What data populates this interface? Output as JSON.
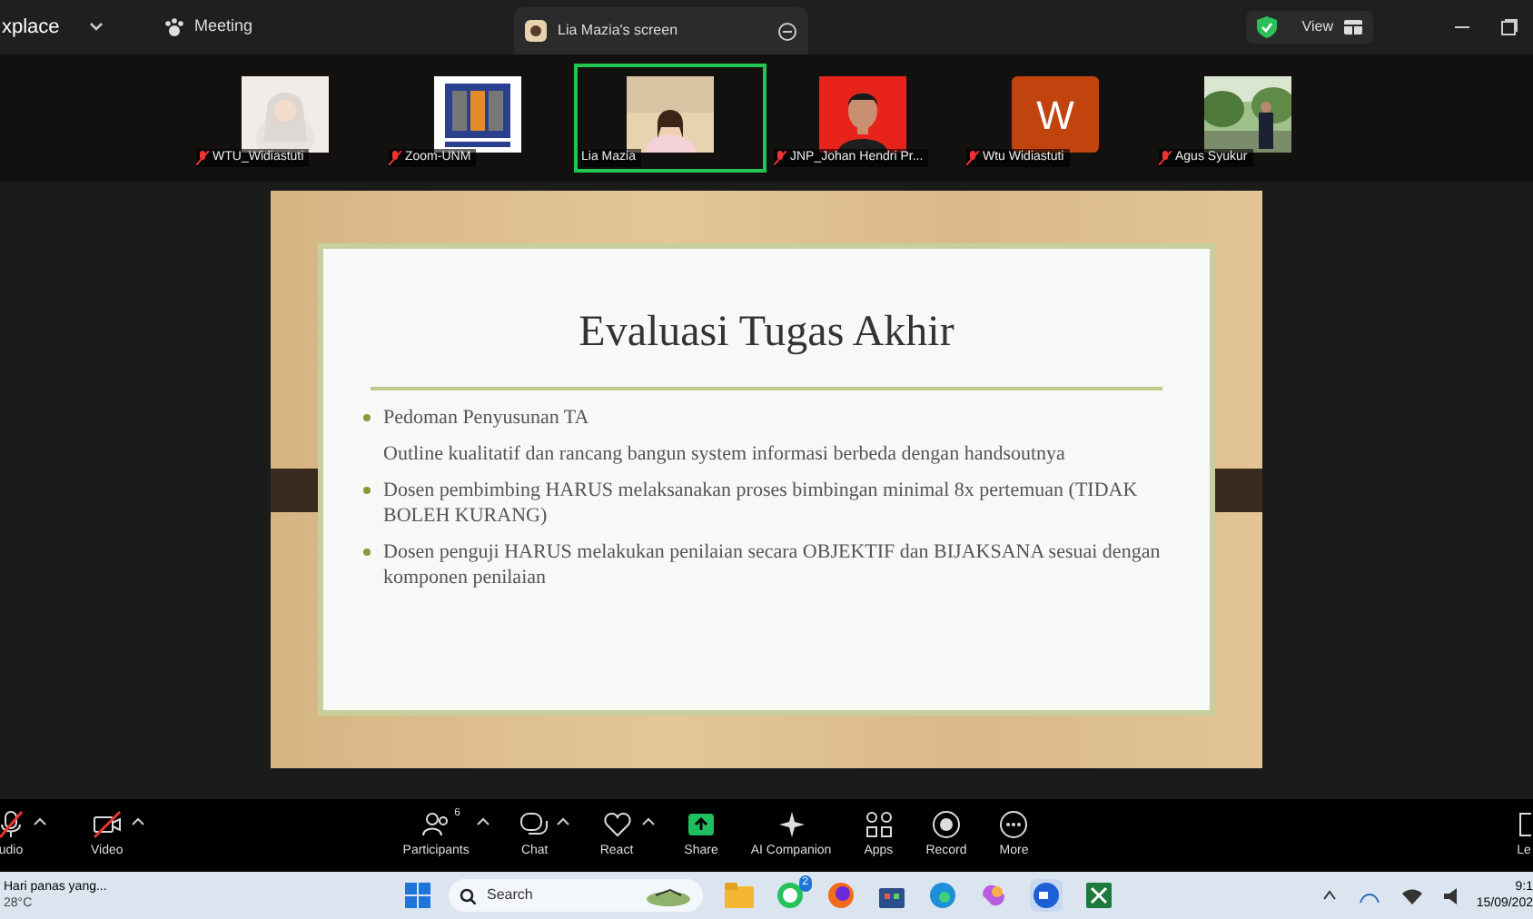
{
  "title_bar": {
    "app_name": "xplace",
    "meeting_tab": "Meeting",
    "share_tab": "Lia Mazia's screen",
    "view_button": "View"
  },
  "participants": [
    {
      "name": "WTU_Widiastuti",
      "kind": "picture",
      "muted": true,
      "selected": false
    },
    {
      "name": "Zoom-UNM",
      "kind": "picture",
      "muted": true,
      "selected": false
    },
    {
      "name": "Lia Mazia",
      "kind": "picture",
      "muted": false,
      "selected": true
    },
    {
      "name": "JNP_Johan Hendri Pr...",
      "kind": "picture",
      "muted": true,
      "selected": false
    },
    {
      "name": "Wtu Widiastuti",
      "kind": "letter",
      "letter": "W",
      "muted": true,
      "selected": false
    },
    {
      "name": "Agus Syukur",
      "kind": "picture",
      "muted": true,
      "selected": false
    }
  ],
  "slide": {
    "title": "Evaluasi Tugas Akhir",
    "items": [
      {
        "text": "Pedoman Penyusunan TA",
        "bullet": true
      },
      {
        "text": "Outline kualitatif dan rancang bangun system informasi berbeda dengan handsoutnya",
        "bullet": false
      },
      {
        "text": "Dosen pembimbing HARUS melaksanakan proses bimbingan minimal 8x pertemuan (TIDAK BOLEH KURANG)",
        "bullet": true
      },
      {
        "text": "Dosen penguji HARUS melakukan penilaian secara OBJEKTIF dan BIJAKSANA sesuai dengan komponen penilaian",
        "bullet": true
      }
    ]
  },
  "toolbar": {
    "left": [
      {
        "label": "udio",
        "kind": "mic",
        "off": true
      },
      {
        "label": "Video",
        "kind": "video",
        "off": true
      }
    ],
    "center": [
      {
        "label": "Participants",
        "kind": "participants",
        "count": "6",
        "caret": true
      },
      {
        "label": "Chat",
        "kind": "chat",
        "caret": true
      },
      {
        "label": "React",
        "kind": "react",
        "caret": true
      },
      {
        "label": "Share",
        "kind": "share",
        "caret": false
      },
      {
        "label": "AI Companion",
        "kind": "ai",
        "caret": false
      },
      {
        "label": "Apps",
        "kind": "apps",
        "caret": false
      },
      {
        "label": "Record",
        "kind": "record",
        "caret": false
      },
      {
        "label": "More",
        "kind": "more",
        "caret": false
      }
    ],
    "right": {
      "label": "Le"
    }
  },
  "taskbar": {
    "weather": "Hari panas yang...",
    "temperature": "28°C",
    "search_placeholder": "Search",
    "whatsapp_badge": "2",
    "time": "9:1",
    "date": "15/09/202"
  }
}
